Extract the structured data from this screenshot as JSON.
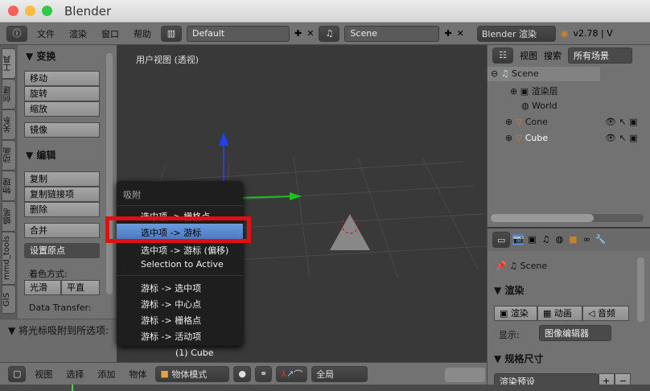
{
  "window": {
    "title": "Blender"
  },
  "header": {
    "menus": [
      "文件",
      "渲染",
      "窗口",
      "帮助"
    ],
    "layout": "Default",
    "scene": "Scene",
    "engine": "Blender 渲染",
    "version": "v2.78 | V"
  },
  "left_tabs": [
    "工具",
    "创建",
    "关系",
    "动画",
    "物理",
    "蜡笔",
    "mmd_tools",
    "GIS"
  ],
  "tool_panel": {
    "transform_title": "变换",
    "transform": [
      "移动",
      "旋转",
      "缩放"
    ],
    "mirror": "镜像",
    "edit_title": "编辑",
    "edit": [
      "复制",
      "复制链接项",
      "删除"
    ],
    "join": "合并",
    "set_origin": "设置原点",
    "shading_label": "着色方式:",
    "smooth": "光滑",
    "flat": "平直",
    "data_transfer": "Data Transfer:",
    "operator_title": "将光标吸附到所选项:"
  },
  "viewport": {
    "label": "用户视图 (透视)",
    "object_label": "(1) Cube"
  },
  "snap_menu": {
    "title": "吸附",
    "items": [
      "选中项 -> 栅格点",
      "选中项 -> 游标",
      "选中项 -> 游标 (偏移)",
      "Selection to Active",
      "游标 -> 选中项",
      "游标 -> 中心点",
      "游标 -> 栅格点",
      "游标 -> 活动项"
    ],
    "highlighted_index": 1,
    "highlight_color": "#e01010"
  },
  "outliner": {
    "menus": [
      "视图",
      "搜索"
    ],
    "filter": "所有场景",
    "items": [
      "Scene",
      "渲染层",
      "World",
      "Cone",
      "Cube"
    ]
  },
  "properties": {
    "context": "Scene",
    "render_title": "渲染",
    "render_btn": "渲染",
    "anim_btn": "动画",
    "audio_btn": "音频",
    "display_label": "显示:",
    "display_value": "图像编辑器",
    "dimensions_title": "规格尺寸",
    "preset": "渲染预设"
  },
  "bottom_header": {
    "menus": [
      "视图",
      "选择",
      "添加",
      "物体"
    ],
    "mode": "物体模式",
    "orientation": "全局"
  }
}
